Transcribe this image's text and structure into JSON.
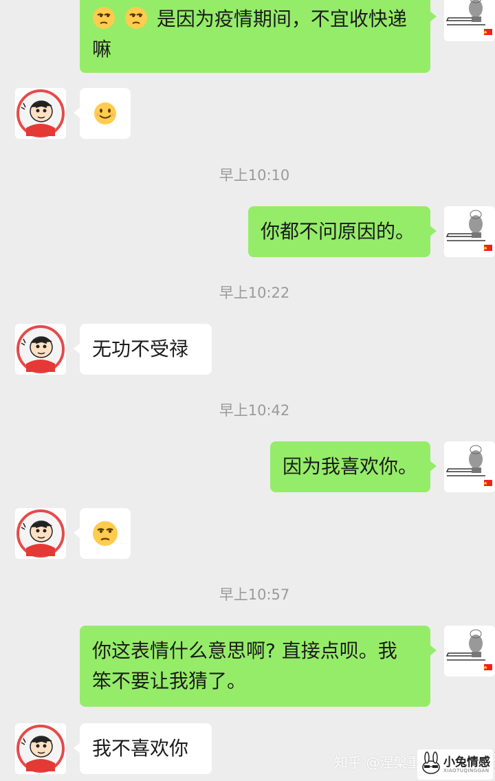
{
  "messages": {
    "m1_text_line1": "是因为疫情期间，不宜收快递",
    "m1_text_line2": "嘛",
    "t1": "早上10:10",
    "m3_text": "你都不问原因的。",
    "t2": "早上10:22",
    "m4_text": "无功不受禄",
    "t3": "早上10:42",
    "m5_text": "因为我喜欢你。",
    "t4": "早上10:57",
    "m7_text_line1": "你这表情什么意思啊? 直接点呗。我",
    "m7_text_line2": "笨不要让我猜了。",
    "m8_text": "我不喜欢你"
  },
  "watermark": {
    "zhihu": "知乎 @涅槃重",
    "logo_title": "小兔情感",
    "logo_sub": "XIAOTUQINGGAN"
  },
  "colors": {
    "background": "#ededed",
    "my_bubble": "#95ec69",
    "their_bubble": "#ffffff",
    "timestamp": "#9a9a9a"
  },
  "icons": {
    "my_avatar": "sketch-robot-avatar-icon",
    "their_avatar": "crayon-shinchan-avatar-icon",
    "unamused_emoji": "unamused-face-icon",
    "smile_emoji": "smiling-face-icon"
  }
}
